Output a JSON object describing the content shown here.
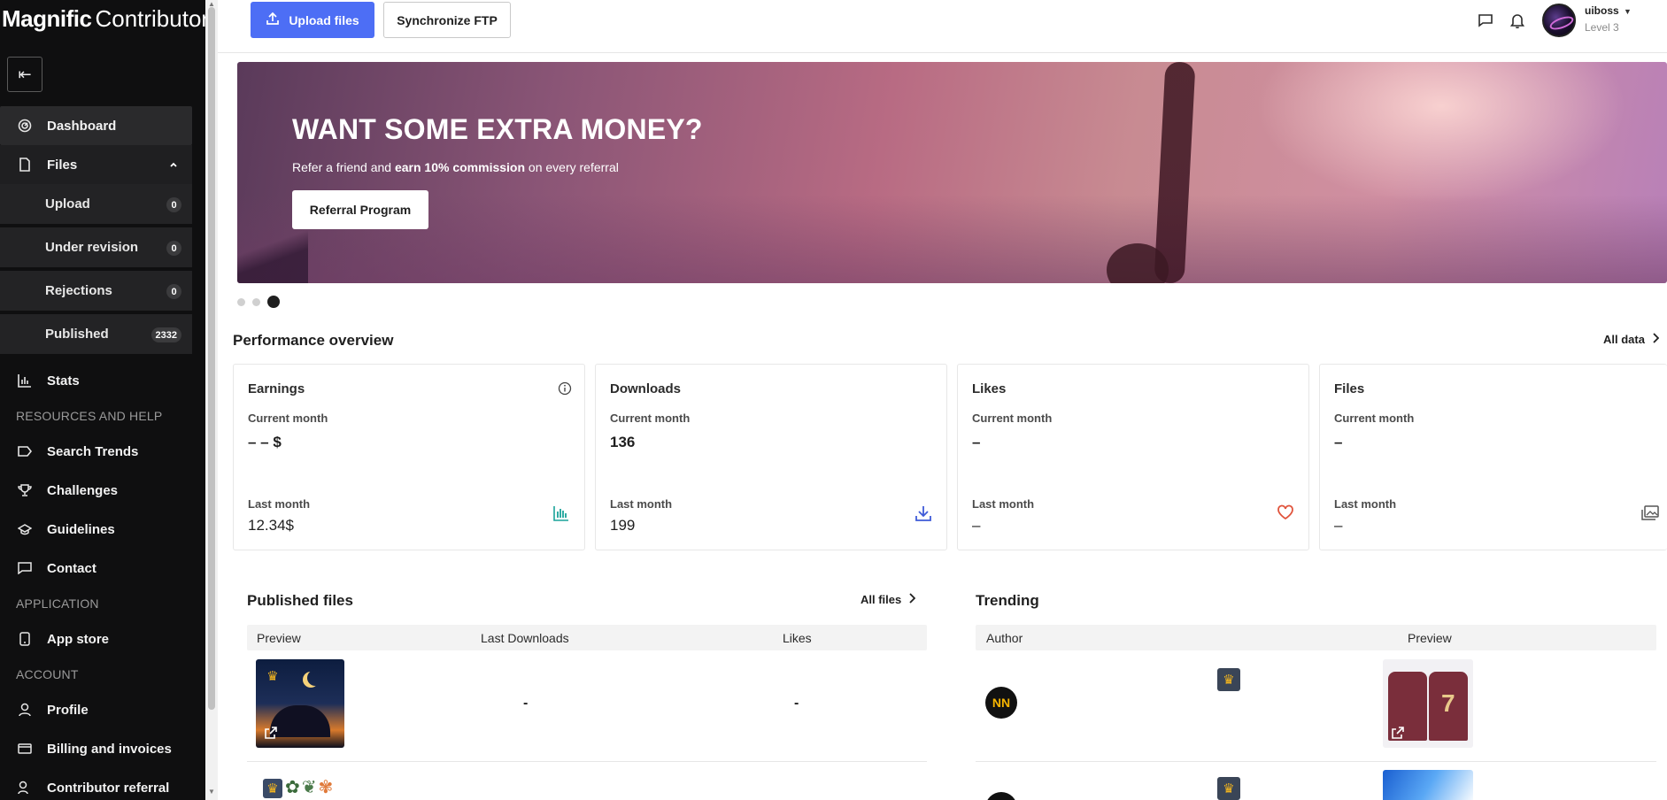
{
  "brand": {
    "bold": "Magnific",
    "light": "Contributors"
  },
  "sidebar": {
    "collapse_icon": "collapse-left-icon",
    "items": {
      "dashboard": "Dashboard",
      "files": "Files",
      "stats": "Stats",
      "search_trends": "Search Trends",
      "challenges": "Challenges",
      "guidelines": "Guidelines",
      "contact": "Contact",
      "app_store": "App store",
      "profile": "Profile",
      "billing": "Billing and invoices",
      "referral": "Contributor referral"
    },
    "sub_items": [
      {
        "label": "Upload",
        "count": "0"
      },
      {
        "label": "Under revision",
        "count": "0"
      },
      {
        "label": "Rejections",
        "count": "0"
      },
      {
        "label": "Published",
        "count": "2332"
      }
    ],
    "sections": {
      "resources": "RESOURCES AND HELP",
      "application": "APPLICATION",
      "account": "ACCOUNT"
    }
  },
  "topbar": {
    "upload_label": "Upload files",
    "ftp_label": "Synchronize FTP",
    "user": {
      "name": "uiboss",
      "level": "Level 3"
    }
  },
  "banner": {
    "title": "WANT SOME EXTRA MONEY?",
    "sub_pre": "Refer a friend and ",
    "sub_bold": "earn 10% commission",
    "sub_post": " on every referral",
    "button": "Referral Program",
    "slides": 3,
    "active_slide": 3
  },
  "performance": {
    "title": "Performance overview",
    "all_data": "All data",
    "cards": [
      {
        "title": "Earnings",
        "current_label": "Current month",
        "current_value": "– – $",
        "last_label": "Last month",
        "last_value": "12.34$",
        "icon": "bar-chart-icon",
        "color": "#1aa39a"
      },
      {
        "title": "Downloads",
        "current_label": "Current month",
        "current_value": "136",
        "last_label": "Last month",
        "last_value": "199",
        "icon": "download-icon",
        "color": "#3f5bd8"
      },
      {
        "title": "Likes",
        "current_label": "Current month",
        "current_value": "–",
        "last_label": "Last month",
        "last_value": "–",
        "icon": "heart-icon",
        "color": "#e0533b"
      },
      {
        "title": "Files",
        "current_label": "Current month",
        "current_value": "–",
        "last_label": "Last month",
        "last_value": "–",
        "icon": "images-icon",
        "color": "#555555"
      }
    ]
  },
  "published": {
    "title": "Published files",
    "all_files": "All files",
    "columns": [
      "Preview",
      "Last Downloads",
      "Likes"
    ],
    "rows": [
      {
        "last_downloads": "-",
        "likes": "-"
      }
    ]
  },
  "trending": {
    "title": "Trending",
    "columns": [
      "Author",
      "Preview"
    ],
    "author_initials": "NN"
  }
}
